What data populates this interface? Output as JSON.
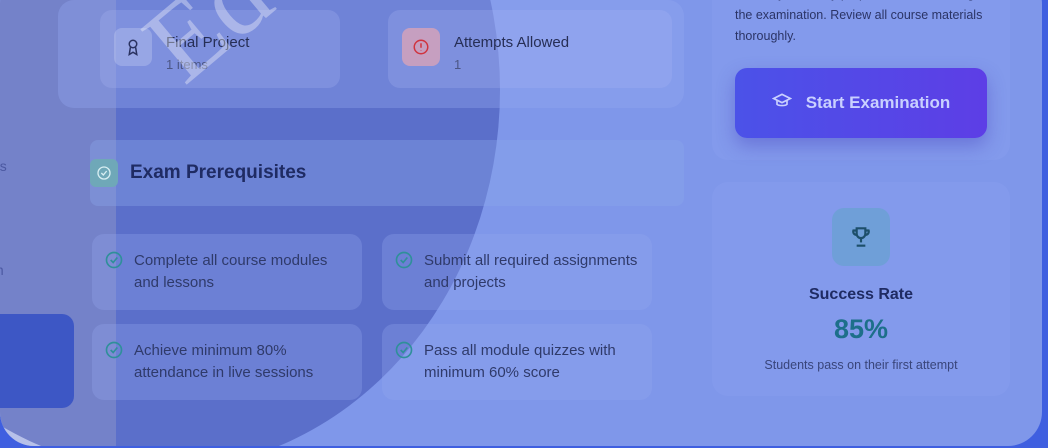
{
  "sidebar": {
    "items": [
      {
        "label": "n"
      },
      {
        "label": "ns"
      },
      {
        "label": "m"
      }
    ]
  },
  "watermark": {
    "text": "Edu"
  },
  "info_tiles": [
    {
      "title": "Final Project",
      "subtitle": "1 items",
      "icon": "award-icon"
    },
    {
      "title": "Attempts Allowed",
      "subtitle": "1",
      "icon": "alert-circle-icon"
    }
  ],
  "prerequisites": {
    "title": "Exam Prerequisites",
    "items": [
      {
        "text": "Complete all course modules and lessons"
      },
      {
        "text": "Submit all required assignments and projects"
      },
      {
        "text": "Achieve minimum 80% attendance in live sessions"
      },
      {
        "text": "Pass all module quizzes with minimum 60% score"
      }
    ]
  },
  "exam_panel": {
    "description": "Ensure you're fully prepared before starting the examination. Review all course materials thoroughly.",
    "start_button_label": "Start Examination",
    "start_button_icon": "graduation-cap-icon"
  },
  "success": {
    "title": "Success Rate",
    "value": "85%",
    "subtitle": "Students pass on their first attempt",
    "icon": "trophy-icon"
  },
  "colors": {
    "accent": "#4b52e8",
    "success_value": "#1d6f8a"
  }
}
